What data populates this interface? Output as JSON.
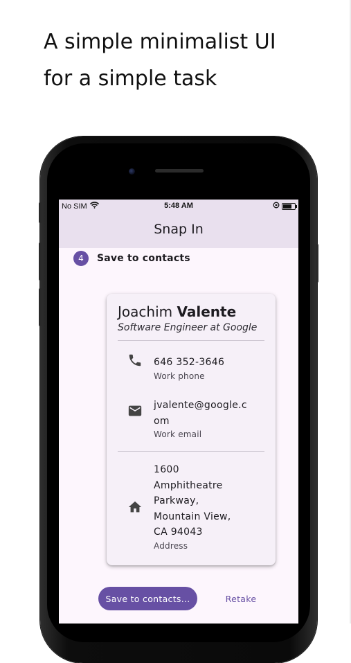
{
  "headline": {
    "line1": "A simple minimalist UI",
    "line2": "for a simple task"
  },
  "status_bar": {
    "carrier": "No SIM",
    "time": "5:48 AM",
    "battery_level": 0.75
  },
  "app_bar": {
    "title": "Snap In"
  },
  "step": {
    "number": "4",
    "title": "Save to contacts"
  },
  "contact": {
    "first_name": "Joachim",
    "last_name": "Valente",
    "job_title": "Software Engineer at Google",
    "phone": {
      "value": "646 352-3646",
      "label": "Work phone"
    },
    "email": {
      "value_line1": "jvalente@google.c",
      "value_line2": "om",
      "label": "Work email"
    },
    "address": {
      "lines": [
        "1600",
        "Amphitheatre",
        "Parkway,",
        "Mountain View,",
        "CA 94043"
      ],
      "label": "Address"
    }
  },
  "actions": {
    "save_label": "Save to contacts...",
    "retake_label": "Retake"
  },
  "colors": {
    "primary": "#6750a4",
    "app_bar": "#e9e0ee",
    "screen_background": "#fdf6fd",
    "card": "#f6f0f8"
  },
  "icons": {
    "signal": "wifi-icon",
    "phone": "phone-icon",
    "email": "mail-icon",
    "address": "home-icon"
  }
}
